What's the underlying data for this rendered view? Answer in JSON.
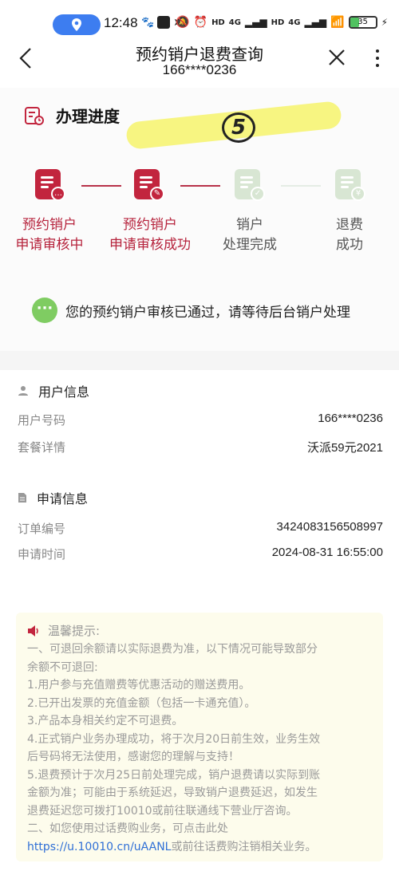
{
  "status_bar": {
    "time": "12:48",
    "battery": "35",
    "net_labels": [
      "HD",
      "4G",
      "HD",
      "4G"
    ]
  },
  "header": {
    "title": "预约销户退费查询",
    "subtitle": "166****0236"
  },
  "progress": {
    "section_title": "办理进度",
    "annotation": "5",
    "steps": [
      {
        "line1": "预约销户",
        "line2": "申请审核中",
        "state": "done"
      },
      {
        "line1": "预约销户",
        "line2": "申请审核成功",
        "state": "done"
      },
      {
        "line1": "销户",
        "line2": "处理完成",
        "state": "pending"
      },
      {
        "line1": "退费",
        "line2": "成功",
        "state": "pending"
      }
    ],
    "status_text": "您的预约销户审核已通过，请等待后台销户处理"
  },
  "user_info": {
    "title": "用户信息",
    "rows": [
      {
        "label": "用户号码",
        "value": "166****0236"
      },
      {
        "label": "套餐详情",
        "value": "沃派59元2021"
      }
    ]
  },
  "apply_info": {
    "title": "申请信息",
    "rows": [
      {
        "label": "订单编号",
        "value": "3424083156508997"
      },
      {
        "label": "申请时间",
        "value": "2024-08-31 16:55:00"
      }
    ]
  },
  "tips": {
    "title": "温馨提示:",
    "lines": [
      "一、可退回余额请以实际退费为准，以下情况可能导致部分",
      "余额不可退回:",
      "1.用户参与充值赠费等优惠活动的赠送费用。",
      "2.已开出发票的充值金额（包括一卡通充值）。",
      "3.产品本身相关约定不可退费。",
      "4.正式销户业务办理成功，将于次月20日前生效，业务生效",
      "后号码将无法使用，感谢您的理解与支持！",
      "5.退费预计于次月25日前处理完成，销户退费请以实际到账",
      "金额为准；可能由于系统延迟，导致销户退费延迟，如发生",
      "退费延迟您可拨打10010或前往联通线下营业厅咨询。",
      "二、如您使用过话费购业务，可点击此处"
    ],
    "link_text": "https://u.10010.cn/uAANL",
    "link_suffix": "或前往话费购注销相关业务。"
  },
  "colors": {
    "brand": "#c2253e",
    "inactive": "#d8e6d3",
    "status_dot": "#7fcc62",
    "link": "#2f6fd6",
    "tips_bg": "#fdfcec"
  }
}
